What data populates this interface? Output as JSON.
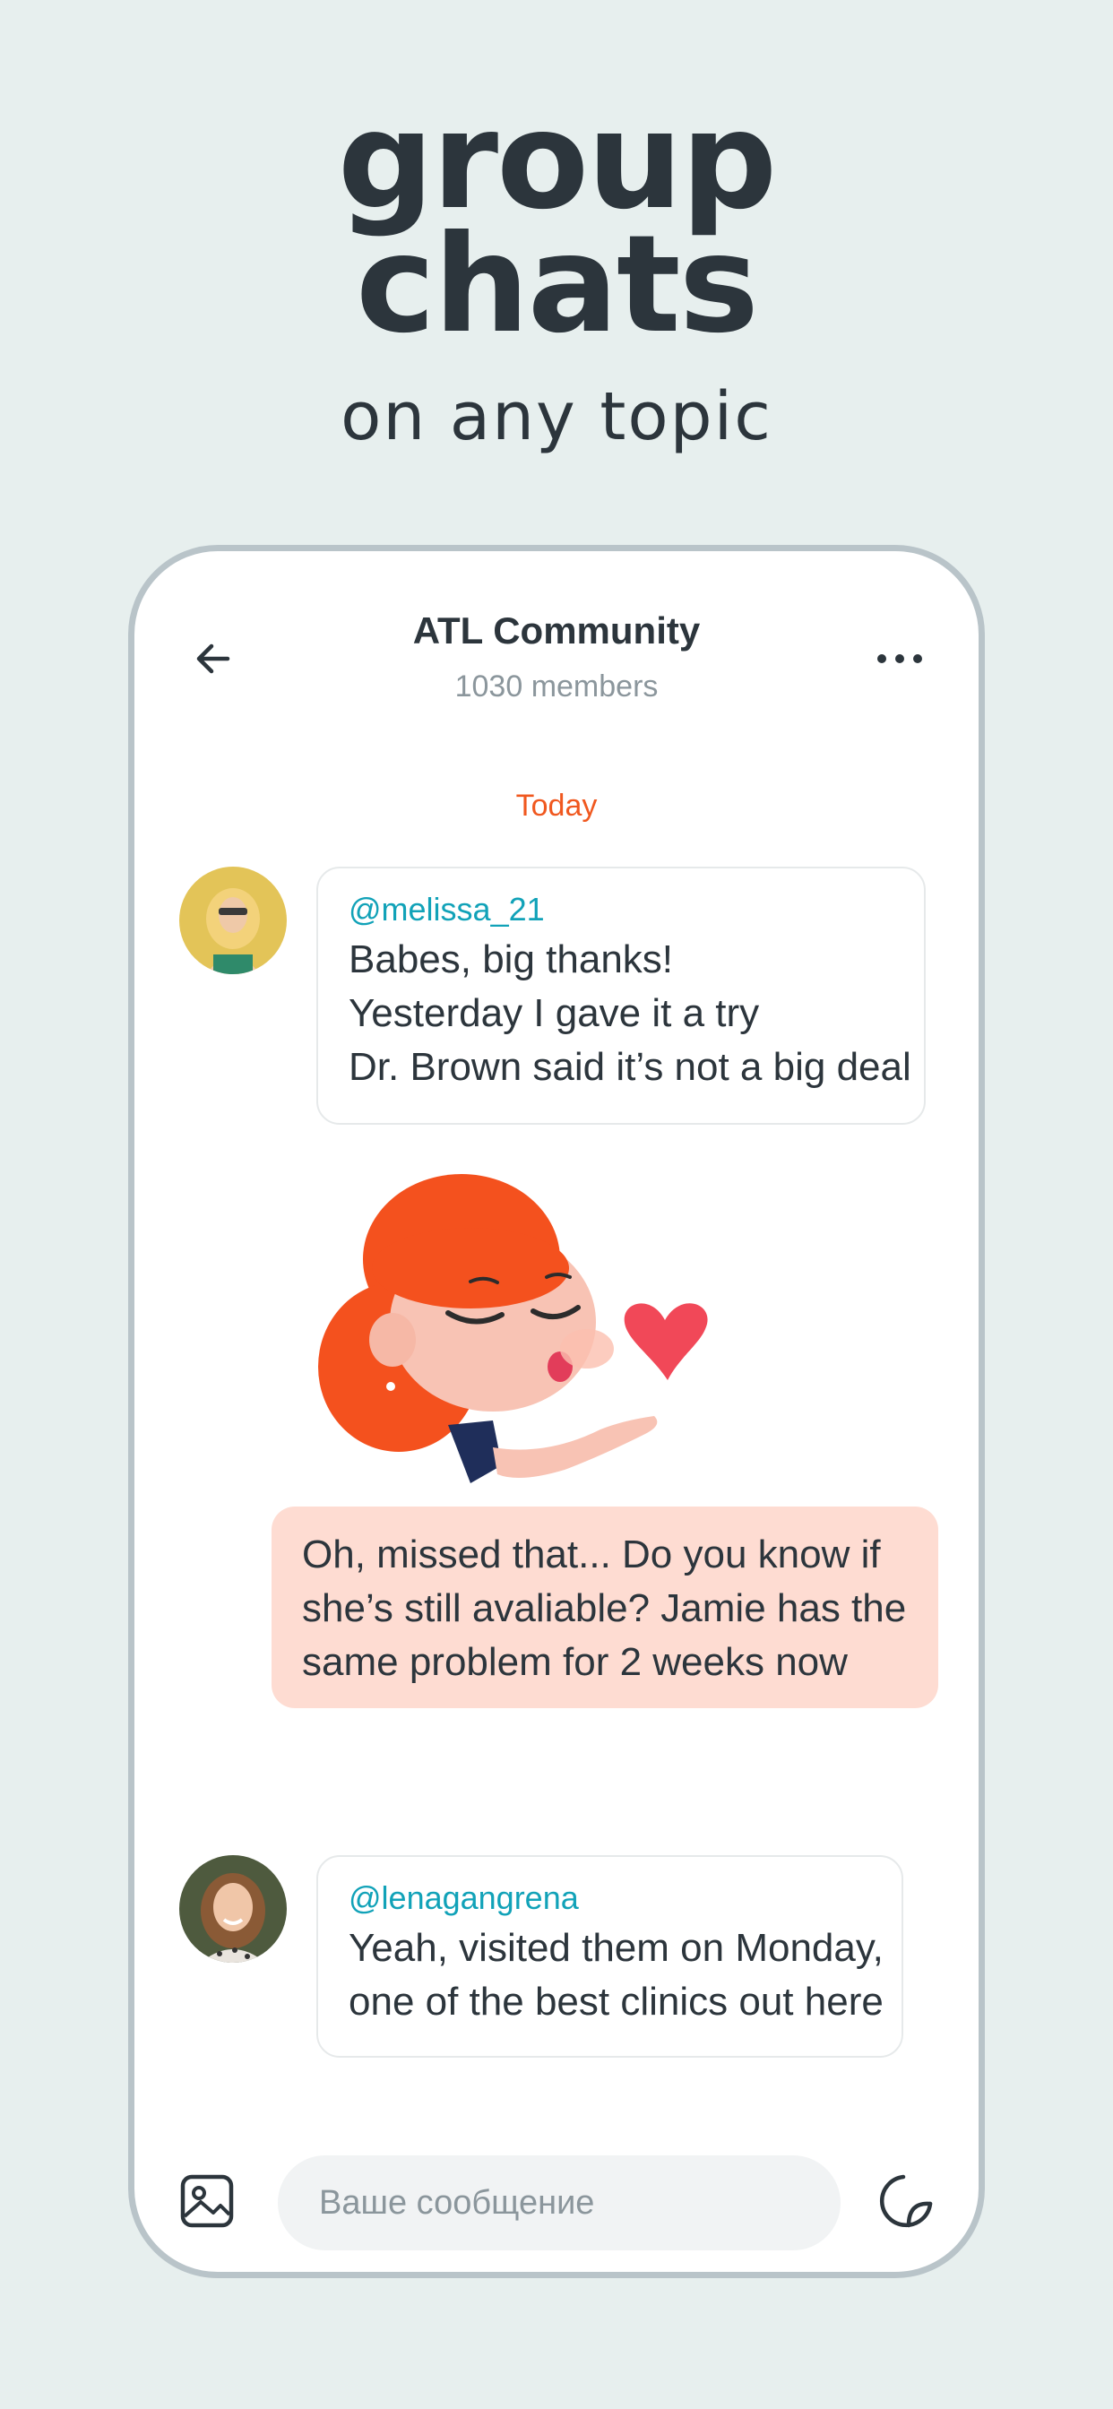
{
  "hero": {
    "line1": "group",
    "line2": "chats",
    "line3": "on any topic"
  },
  "chat_header": {
    "title": "ATL Community",
    "members": "1030 members",
    "back_icon": "arrow-left-icon",
    "menu_icon": "more-horizontal-icon"
  },
  "date_separator": "Today",
  "messages": [
    {
      "handle": "@melissa_21",
      "lines": [
        "Babes, big thanks!",
        "Yesterday I gave it a try",
        "Dr. Brown said it’s not a big deal"
      ]
    },
    {
      "own": true,
      "lines": [
        "Oh, missed that... Do you know if",
        "she’s still avaliable? Jamie has the",
        "same problem for 2 weeks now"
      ]
    },
    {
      "handle": "@lenagangrena",
      "lines": [
        "Yeah, visited them on Monday,",
        "one of the best clinics out here"
      ]
    }
  ],
  "composer": {
    "placeholder": "Ваше сообщение",
    "attach_icon": "image-icon",
    "sticker_icon": "sticker-icon"
  },
  "colors": {
    "background": "#e7efee",
    "accent_orange": "#f0581f",
    "handle_teal": "#11a2b8",
    "own_bubble": "#fedcd2"
  }
}
